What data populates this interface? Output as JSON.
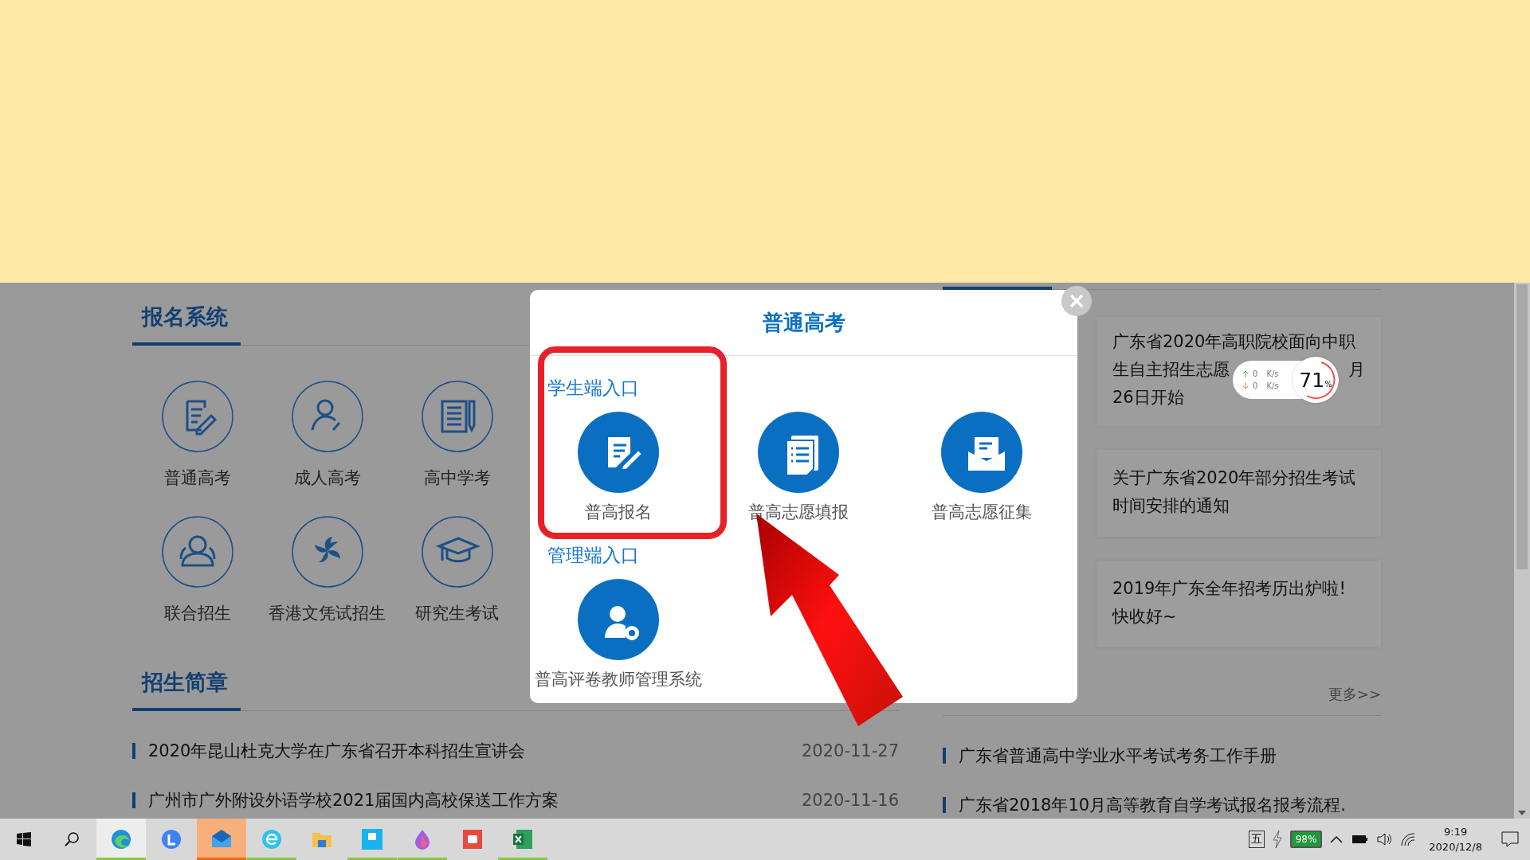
{
  "registration": {
    "title": "报名系统",
    "items": [
      "普通高考",
      "成人高考",
      "高中学考",
      "联合招生",
      "香港文凭试招生",
      "研究生考试"
    ]
  },
  "brochure": {
    "title": "招生简章",
    "items": [
      {
        "title": "2020年昆山杜克大学在广东省召开本科招生宣讲会",
        "date": "2020-11-27"
      },
      {
        "title": "广州市广外附设外语学校2021届国内高校保送工作方案",
        "date": "2020-11-16"
      }
    ]
  },
  "news": {
    "cards": [
      {
        "lines": [
          [
            "广东省2020年高职院校面向中职"
          ],
          [
            "生自主招生志愿",
            "月"
          ],
          [
            "26日开始"
          ]
        ]
      },
      {
        "lines": [
          [
            "关于广东省2020年部分招生考试"
          ],
          [
            "时间安排的通知"
          ]
        ]
      },
      {
        "lines": [
          [
            "2019年广东全年招考历出炉啦!"
          ],
          [
            "快收好~"
          ]
        ]
      }
    ],
    "more": "更多>>",
    "items": [
      "广东省普通高中学业水平考试考务工作手册",
      "广东省2018年10月高等教育自学考试报名报考流程."
    ]
  },
  "modal": {
    "title": "普通高考",
    "sections": [
      {
        "label": "学生端入口",
        "items": [
          "普高报名",
          "普高志愿填报",
          "普高志愿征集"
        ]
      },
      {
        "label": "管理端入口",
        "items": [
          "普高评卷教师管理系统"
        ]
      }
    ]
  },
  "speed_widget": {
    "up": {
      "value": "0",
      "unit": "K/s"
    },
    "down": {
      "value": "0",
      "unit": "K/s"
    },
    "usage": "71",
    "percent": "%"
  },
  "taskbar": {
    "apps": [
      {
        "selected": true,
        "running": true,
        "flashing": false
      },
      {
        "selected": false,
        "running": false,
        "flashing": false
      },
      {
        "selected": false,
        "running": true,
        "flashing": true
      },
      {
        "selected": false,
        "running": true,
        "flashing": false
      },
      {
        "selected": false,
        "running": false,
        "flashing": false
      },
      {
        "selected": false,
        "running": true,
        "flashing": false
      },
      {
        "selected": false,
        "running": true,
        "flashing": false
      },
      {
        "selected": false,
        "running": false,
        "flashing": false
      },
      {
        "selected": false,
        "running": true,
        "flashing": false
      }
    ],
    "tray": {
      "ime": "五",
      "battery": "98%",
      "time": "9:19",
      "date": "2020/12/8"
    }
  }
}
